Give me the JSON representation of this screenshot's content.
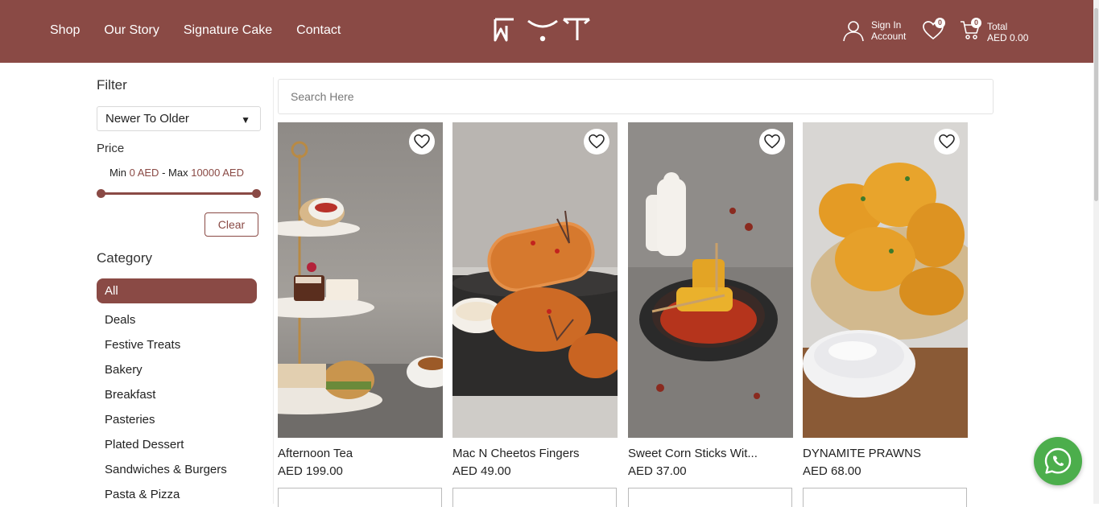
{
  "header": {
    "nav": [
      "Shop",
      "Our Story",
      "Signature Cake",
      "Contact"
    ],
    "logo_text": "WYT",
    "account": {
      "line1": "Sign In",
      "line2": "Account"
    },
    "wishlist_count": "0",
    "cart": {
      "count": "0",
      "label": "Total",
      "total": "AED 0.00"
    }
  },
  "filter": {
    "title": "Filter",
    "sort_selected": "Newer To Older",
    "price_label": "Price",
    "min_label": "Min",
    "min_value": "0 AED",
    "separator": "-",
    "max_label": "Max",
    "max_value": "10000 AED",
    "clear_label": "Clear",
    "category_label": "Category",
    "categories": [
      "All",
      "Deals",
      "Festive Treats",
      "Bakery",
      "Breakfast",
      "Pasteries",
      "Plated Dessert",
      "Sandwiches & Burgers",
      "Pasta & Pizza"
    ]
  },
  "search": {
    "placeholder": "Search Here"
  },
  "products": [
    {
      "name": "Afternoon Tea",
      "price": "AED 199.00"
    },
    {
      "name": "Mac N Cheetos Fingers",
      "price": "AED 49.00"
    },
    {
      "name": "Sweet Corn Sticks Wit...",
      "price": "AED 37.00"
    },
    {
      "name": "DYNAMITE PRAWNS",
      "price": "AED 68.00"
    }
  ],
  "colors": {
    "brand": "#8a4a45",
    "whatsapp": "#4cae4c"
  }
}
